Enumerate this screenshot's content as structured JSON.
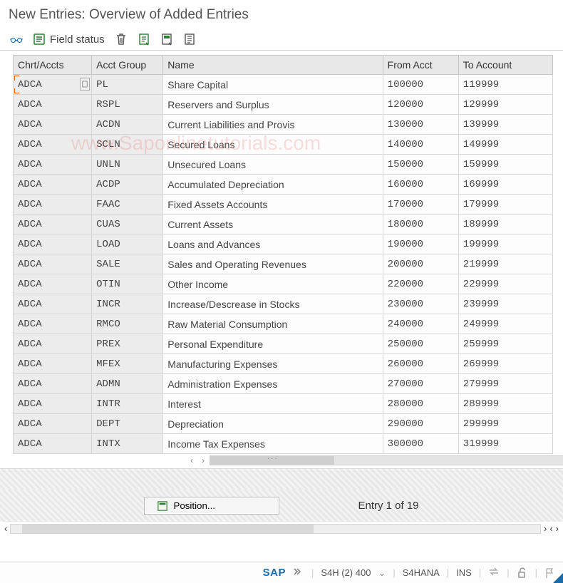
{
  "title": "New Entries: Overview of Added Entries",
  "toolbar": {
    "field_status": "Field status"
  },
  "columns": {
    "chrt": "Chrt/Accts",
    "group": "Acct Group",
    "name": "Name",
    "from": "From Acct",
    "to": "To Account"
  },
  "rows": [
    {
      "chrt": "ADCA",
      "group": "PL",
      "name": "Share Capital",
      "from": "100000",
      "to": "119999"
    },
    {
      "chrt": "ADCA",
      "group": "RSPL",
      "name": "Reservers and Surplus",
      "from": "120000",
      "to": "129999"
    },
    {
      "chrt": "ADCA",
      "group": "ACDN",
      "name": "Current Liabilities and Provis",
      "from": "130000",
      "to": "139999"
    },
    {
      "chrt": "ADCA",
      "group": "SCLN",
      "name": "Secured Loans",
      "from": "140000",
      "to": "149999"
    },
    {
      "chrt": "ADCA",
      "group": "UNLN",
      "name": "Unsecured Loans",
      "from": "150000",
      "to": "159999"
    },
    {
      "chrt": "ADCA",
      "group": "ACDP",
      "name": "Accumulated Depreciation",
      "from": "160000",
      "to": "169999"
    },
    {
      "chrt": "ADCA",
      "group": "FAAC",
      "name": "Fixed Assets Accounts",
      "from": "170000",
      "to": "179999"
    },
    {
      "chrt": "ADCA",
      "group": "CUAS",
      "name": "Current Assets",
      "from": "180000",
      "to": "189999"
    },
    {
      "chrt": "ADCA",
      "group": "LOAD",
      "name": "Loans and Advances",
      "from": "190000",
      "to": "199999"
    },
    {
      "chrt": "ADCA",
      "group": "SALE",
      "name": "Sales and Operating Revenues",
      "from": "200000",
      "to": "219999"
    },
    {
      "chrt": "ADCA",
      "group": "OTIN",
      "name": "Other Income",
      "from": "220000",
      "to": "229999"
    },
    {
      "chrt": "ADCA",
      "group": "INCR",
      "name": "Increase/Descrease in Stocks",
      "from": "230000",
      "to": "239999"
    },
    {
      "chrt": "ADCA",
      "group": "RMCO",
      "name": "Raw Material Consumption",
      "from": "240000",
      "to": "249999"
    },
    {
      "chrt": "ADCA",
      "group": "PREX",
      "name": "Personal Expenditure",
      "from": "250000",
      "to": "259999"
    },
    {
      "chrt": "ADCA",
      "group": "MFEX",
      "name": "Manufacturing Expenses",
      "from": "260000",
      "to": "269999"
    },
    {
      "chrt": "ADCA",
      "group": "ADMN",
      "name": "Administration Expenses",
      "from": "270000",
      "to": "279999"
    },
    {
      "chrt": "ADCA",
      "group": "INTR",
      "name": "Interest",
      "from": "280000",
      "to": "289999"
    },
    {
      "chrt": "ADCA",
      "group": "DEPT",
      "name": "Depreciation",
      "from": "290000",
      "to": "299999"
    },
    {
      "chrt": "ADCA",
      "group": "INTX",
      "name": "Income Tax Expenses",
      "from": "300000",
      "to": "319999"
    }
  ],
  "position_button": "Position...",
  "entry_counter": "Entry 1 of 19",
  "status": {
    "system": "S4H (2) 400",
    "server": "S4HANA",
    "mode": "INS"
  },
  "watermark": "www.Saponlinetutorials.com"
}
